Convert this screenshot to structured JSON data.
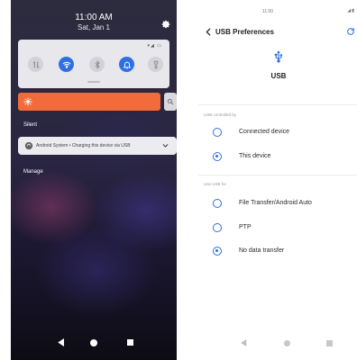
{
  "shade": {
    "time": "11:00 AM",
    "date": "Sat, Jan 1",
    "status_icons": "▾◢ ▭",
    "settings_icon": "gear-icon",
    "quick_toggles": [
      {
        "name": "data-transfer-icon",
        "active": false
      },
      {
        "name": "wifi-icon",
        "active": true
      },
      {
        "name": "bluetooth-icon",
        "active": false
      },
      {
        "name": "notification-bell-icon",
        "active": true
      },
      {
        "name": "flashlight-icon",
        "active": false
      }
    ],
    "brightness_color": "#f26b3a",
    "silent_label": "Silent",
    "notification_text": "Android System • Charging this device via USB",
    "manage_label": "Manage"
  },
  "usb": {
    "time": "11:00",
    "status_icons": "◢▮",
    "title": "USB Preferences",
    "usb_label": "USB",
    "controlled_by_heading": "USB controlled by",
    "controlled_by_options": [
      {
        "label": "Connected device",
        "selected": false
      },
      {
        "label": "This device",
        "selected": true
      }
    ],
    "use_for_heading": "Use USB for",
    "use_for_options": [
      {
        "label": "File Transfer/Android Auto",
        "selected": false
      },
      {
        "label": "PTP",
        "selected": false
      },
      {
        "label": "No data transfer",
        "selected": true
      }
    ],
    "accent_color": "#2f6fe4"
  }
}
